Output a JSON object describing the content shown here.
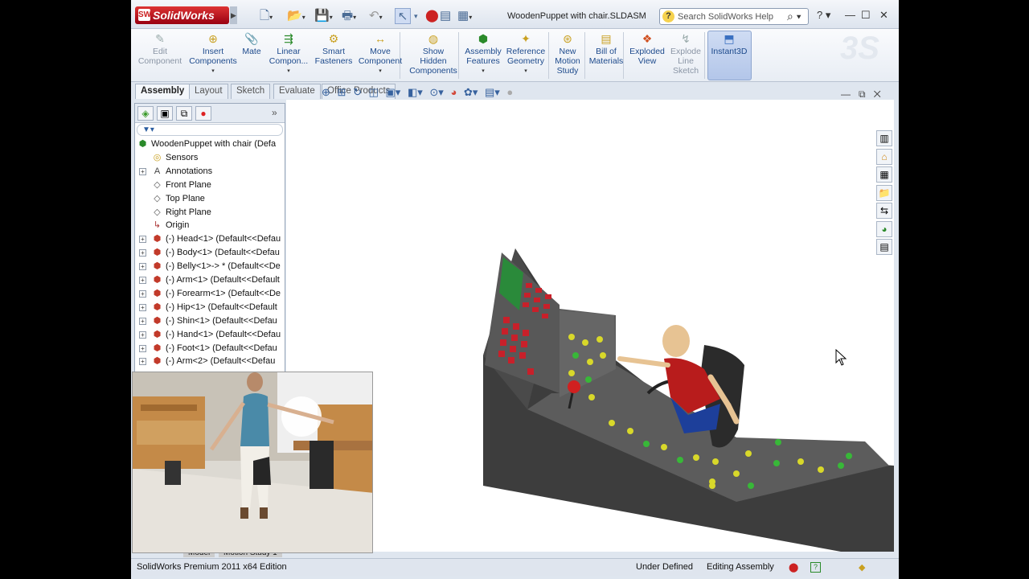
{
  "app": {
    "logo_text": "SolidWorks",
    "document_title": "WoodenPuppet with chair.SLDASM"
  },
  "search": {
    "placeholder": "Search SolidWorks Help"
  },
  "ribbon": {
    "buttons": [
      {
        "label": "Edit\nComponent",
        "icon": "edit-component-icon",
        "disabled": true
      },
      {
        "label": "Insert\nComponents",
        "icon": "insert-components-icon"
      },
      {
        "label": "Mate",
        "icon": "mate-icon"
      },
      {
        "label": "Linear\nCompon...",
        "icon": "linear-pattern-icon"
      },
      {
        "label": "Smart\nFasteners",
        "icon": "smart-fasteners-icon"
      },
      {
        "label": "Move\nComponent",
        "icon": "move-component-icon"
      },
      {
        "label": "Show\nHidden\nComponents",
        "icon": "show-hidden-icon"
      },
      {
        "label": "Assembly\nFeatures",
        "icon": "assembly-features-icon"
      },
      {
        "label": "Reference\nGeometry",
        "icon": "reference-geometry-icon"
      },
      {
        "label": "New\nMotion\nStudy",
        "icon": "motion-study-icon"
      },
      {
        "label": "Bill of\nMaterials",
        "icon": "bom-icon"
      },
      {
        "label": "Exploded\nView",
        "icon": "exploded-view-icon"
      },
      {
        "label": "Explode\nLine\nSketch",
        "icon": "explode-line-icon",
        "disabled": true
      },
      {
        "label": "Instant3D",
        "icon": "instant3d-icon"
      }
    ]
  },
  "tabs": [
    "Assembly",
    "Layout",
    "Sketch",
    "Evaluate",
    "Office Products"
  ],
  "tree": [
    {
      "label": "WoodenPuppet with chair  (Defa",
      "icon": "assembly-icon",
      "expander": ""
    },
    {
      "label": "Sensors",
      "icon": "sensors-icon",
      "expander": ""
    },
    {
      "label": "Annotations",
      "icon": "annotations-icon",
      "expander": "+"
    },
    {
      "label": "Front Plane",
      "icon": "plane-icon",
      "expander": ""
    },
    {
      "label": "Top Plane",
      "icon": "plane-icon",
      "expander": ""
    },
    {
      "label": "Right Plane",
      "icon": "plane-icon",
      "expander": ""
    },
    {
      "label": "Origin",
      "icon": "origin-icon",
      "expander": ""
    },
    {
      "label": "(-) Head<1> (Default<<Defau",
      "icon": "part-icon",
      "expander": "+"
    },
    {
      "label": "(-) Body<1> (Default<<Defau",
      "icon": "part-icon",
      "expander": "+"
    },
    {
      "label": "(-) Belly<1>-> * (Default<<De",
      "icon": "part-icon",
      "expander": "+"
    },
    {
      "label": "(-) Arm<1> (Default<<Default",
      "icon": "part-icon",
      "expander": "+"
    },
    {
      "label": "(-) Forearm<1> (Default<<De",
      "icon": "part-icon",
      "expander": "+"
    },
    {
      "label": "(-) Hip<1> (Default<<Default",
      "icon": "part-icon",
      "expander": "+"
    },
    {
      "label": "(-) Shin<1> (Default<<Defau",
      "icon": "part-icon",
      "expander": "+"
    },
    {
      "label": "(-) Hand<1> (Default<<Defau",
      "icon": "part-icon",
      "expander": "+"
    },
    {
      "label": "(-) Foot<1> (Default<<Defau",
      "icon": "part-icon",
      "expander": "+"
    },
    {
      "label": "(-) Arm<2> (Default<<Defau",
      "icon": "part-icon",
      "expander": "+"
    }
  ],
  "status": {
    "edition": "SolidWorks Premium 2011 x64 Edition",
    "definition": "Under Defined",
    "mode": "Editing Assembly"
  },
  "bottom_tabs": [
    "Model",
    "Motion Study 1"
  ],
  "colors": {
    "accent": "#1d4a8c",
    "panel_bg": "#dfe6ef",
    "logo_red": "#c8262c"
  }
}
